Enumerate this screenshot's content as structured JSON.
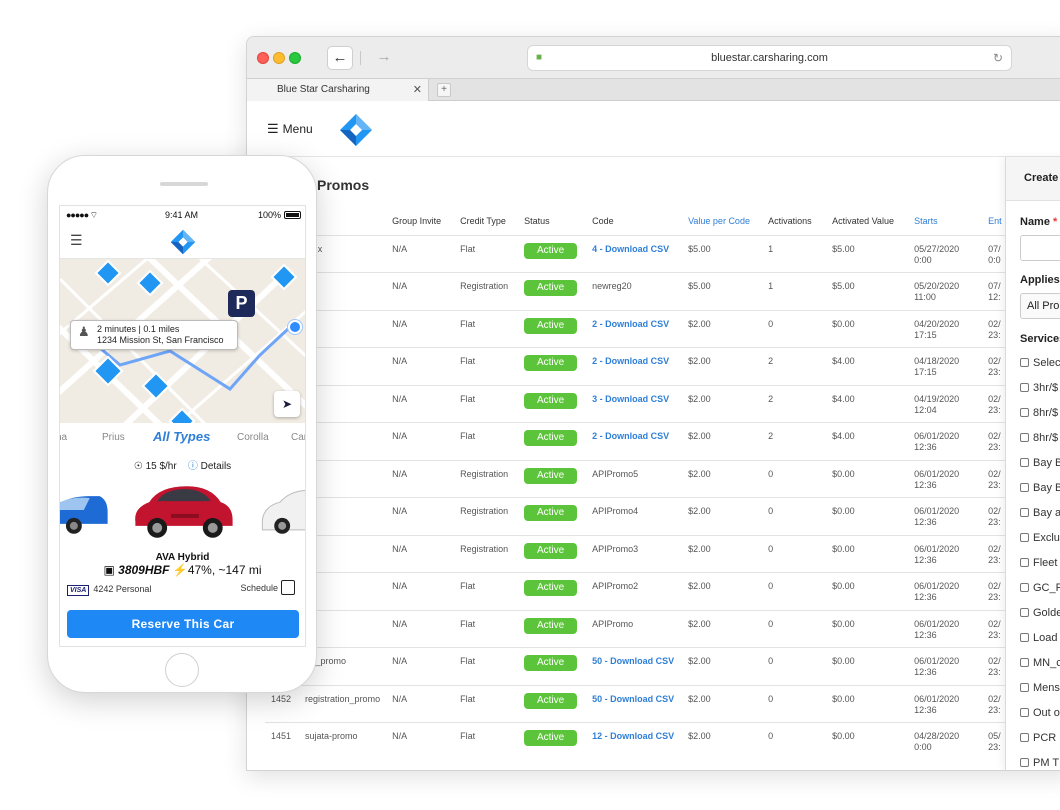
{
  "browser": {
    "url": "bluestar.carsharing.com",
    "tab_title": "Blue Star Carsharing",
    "menu_label": "Menu"
  },
  "page": {
    "title": "Promos",
    "columns": [
      "me",
      "Group Invite",
      "Credit Type",
      "Status",
      "Code",
      "Value per Code",
      "Activations",
      "Activated Value",
      "Starts",
      "Ent"
    ],
    "sortable_columns": [
      "me",
      "Value per Code",
      "Starts",
      "Ent"
    ],
    "rows": [
      {
        "id": "",
        "name": "en's promo x",
        "group": "N/A",
        "credit": "Flat",
        "status": "Active",
        "code": "4 - Download CSV",
        "code_link": true,
        "value": "$5.00",
        "activations": "1",
        "activated": "$5.00",
        "starts": "05/27/2020 0:00",
        "ends": "07/ 0:0"
      },
      {
        "id": "",
        "name": "reg20",
        "group": "N/A",
        "credit": "Registration",
        "status": "Active",
        "code": "newreg20",
        "code_link": false,
        "value": "$5.00",
        "activations": "1",
        "activated": "$5.00",
        "starts": "05/20/2020 11:00",
        "ends": "07/ 12:"
      },
      {
        "id": "",
        "name": "_promo8",
        "group": "N/A",
        "credit": "Flat",
        "status": "Active",
        "code": "2 - Download CSV",
        "code_link": true,
        "value": "$2.00",
        "activations": "0",
        "activated": "$0.00",
        "starts": "04/20/2020 17:15",
        "ends": "02/ 23:"
      },
      {
        "id": "",
        "name": "_promo7",
        "group": "N/A",
        "credit": "Flat",
        "status": "Active",
        "code": "2 - Download CSV",
        "code_link": true,
        "value": "$2.00",
        "activations": "2",
        "activated": "$4.00",
        "starts": "04/18/2020 17:15",
        "ends": "02/ 23:"
      },
      {
        "id": "",
        "name": "_promo6",
        "group": "N/A",
        "credit": "Flat",
        "status": "Active",
        "code": "3 - Download CSV",
        "code_link": true,
        "value": "$2.00",
        "activations": "2",
        "activated": "$4.00",
        "starts": "04/19/2020 12:04",
        "ends": "02/ 23:"
      },
      {
        "id": "",
        "name": "_promo5",
        "group": "N/A",
        "credit": "Flat",
        "status": "Active",
        "code": "2 - Download CSV",
        "code_link": true,
        "value": "$2.00",
        "activations": "2",
        "activated": "$4.00",
        "starts": "06/01/2020 12:36",
        "ends": "02/ 23:"
      },
      {
        "id": "",
        "name": "_promo5",
        "group": "N/A",
        "credit": "Registration",
        "status": "Active",
        "code": "APIPromo5",
        "code_link": false,
        "value": "$2.00",
        "activations": "0",
        "activated": "$0.00",
        "starts": "06/01/2020 12:36",
        "ends": "02/ 23:"
      },
      {
        "id": "",
        "name": "_promo4",
        "group": "N/A",
        "credit": "Registration",
        "status": "Active",
        "code": "APIPromo4",
        "code_link": false,
        "value": "$2.00",
        "activations": "0",
        "activated": "$0.00",
        "starts": "06/01/2020 12:36",
        "ends": "02/ 23:"
      },
      {
        "id": "",
        "name": "_promo3",
        "group": "N/A",
        "credit": "Registration",
        "status": "Active",
        "code": "APIPromo3",
        "code_link": false,
        "value": "$2.00",
        "activations": "0",
        "activated": "$0.00",
        "starts": "06/01/2020 12:36",
        "ends": "02/ 23:"
      },
      {
        "id": "",
        "name": "_promo2",
        "group": "N/A",
        "credit": "Flat",
        "status": "Active",
        "code": "APIPromo2",
        "code_link": false,
        "value": "$2.00",
        "activations": "0",
        "activated": "$0.00",
        "starts": "06/01/2020 12:36",
        "ends": "02/ 23:"
      },
      {
        "id": "",
        "name": "_promo",
        "group": "N/A",
        "credit": "Flat",
        "status": "Active",
        "code": "APIPromo",
        "code_link": false,
        "value": "$2.00",
        "activations": "0",
        "activated": "$0.00",
        "starts": "06/01/2020 12:36",
        "ends": "02/ 23:"
      },
      {
        "id": "",
        "name": "registration_promo",
        "group": "N/A",
        "credit": "Flat",
        "status": "Active",
        "code": "50 - Download CSV",
        "code_link": true,
        "value": "$2.00",
        "activations": "0",
        "activated": "$0.00",
        "starts": "06/01/2020 12:36",
        "ends": "02/ 23:"
      },
      {
        "id": "1452",
        "name": "registration_promo",
        "group": "N/A",
        "credit": "Flat",
        "status": "Active",
        "code": "50 - Download CSV",
        "code_link": true,
        "value": "$2.00",
        "activations": "0",
        "activated": "$0.00",
        "starts": "06/01/2020 12:36",
        "ends": "02/ 23:"
      },
      {
        "id": "1451",
        "name": "sujata-promo",
        "group": "N/A",
        "credit": "Flat",
        "status": "Active",
        "code": "12 - Download CSV",
        "code_link": true,
        "value": "$2.00",
        "activations": "0",
        "activated": "$0.00",
        "starts": "04/28/2020 0:00",
        "ends": "05/ 23:"
      }
    ]
  },
  "panel": {
    "title": "Create",
    "name_label": "Name",
    "required_mark": "*",
    "applies_label": "Applies",
    "applies_value": "All Pro",
    "services_label": "Services",
    "services": [
      "Selec",
      "3hr/$",
      "8hr/$",
      "8hr/$",
      "Bay B",
      "Bay B",
      "Bay a",
      "Exclu",
      "Fleet",
      "GC_P",
      "Golde",
      "Load",
      "MN_c",
      "Mens",
      "Out o",
      "PCR F",
      "PM T"
    ]
  },
  "phone": {
    "status": {
      "signal": "●●●●● ⌔",
      "time": "9:41 AM",
      "battery": "100%"
    },
    "map": {
      "walk_time": "2 minutes | 0.1 miles",
      "address": "1234 Mission St, San Francisco",
      "parking_label": "P"
    },
    "types": [
      "na",
      "Prius",
      "All Types",
      "Corolla",
      "Car"
    ],
    "active_type": "All Types",
    "rate": "15 $/hr",
    "details_label": "Details",
    "car_name": "AVA Hybrid",
    "plate": "3809HBF",
    "charge": "47%, ~147 mi",
    "payment": "4242 Personal",
    "visa_label": "VISA",
    "schedule_label": "Schedule",
    "reserve_label": "Reserve This Car"
  },
  "colors": {
    "accent_blue": "#2f7fd6",
    "active_green": "#5cc43a",
    "reserve_blue": "#1e88f5"
  }
}
